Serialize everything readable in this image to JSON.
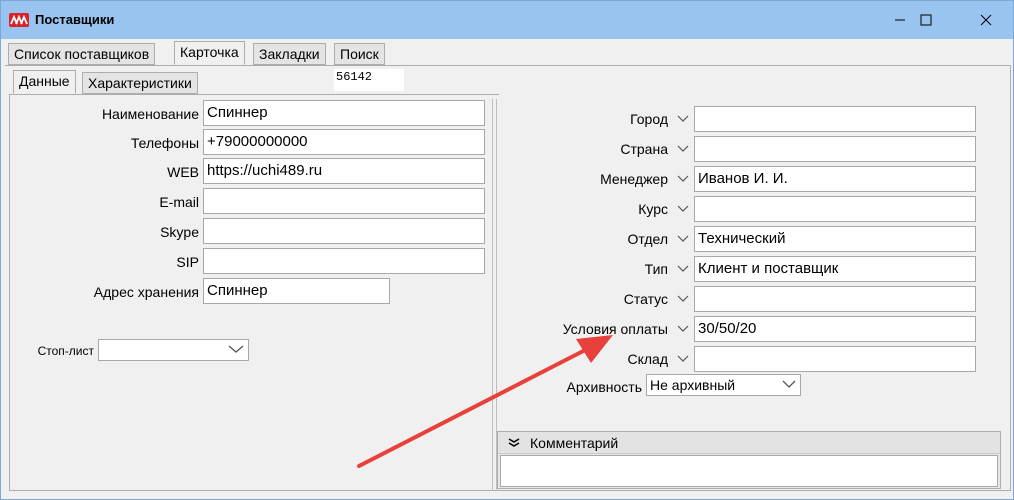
{
  "window": {
    "title": "Поставщики",
    "accent": "#99c4f0"
  },
  "top_tabs": [
    {
      "label": "Список поставщиков",
      "active": false
    },
    {
      "label": "Карточка",
      "active": true
    },
    {
      "label": "Закладки",
      "active": false
    },
    {
      "label": "Поиск",
      "active": false
    }
  ],
  "sub_tabs": [
    {
      "label": "Данные",
      "active": true
    },
    {
      "label": "Характеристики",
      "active": false
    }
  ],
  "record_id": "56142",
  "left_form": {
    "fields": [
      {
        "label": "Наименование",
        "value": "Спиннер"
      },
      {
        "label": "Телефоны",
        "value": "+79000000000"
      },
      {
        "label": "WEB",
        "value": "https://uchi489.ru"
      },
      {
        "label": "E-mail",
        "value": ""
      },
      {
        "label": "Skype",
        "value": ""
      },
      {
        "label": "SIP",
        "value": ""
      },
      {
        "label": "Адрес хранения",
        "value": "Спиннер"
      }
    ],
    "stoplist": {
      "label": "Стоп-лист",
      "value": ""
    }
  },
  "right_form": {
    "fields": [
      {
        "label": "Город",
        "value": ""
      },
      {
        "label": "Страна",
        "value": ""
      },
      {
        "label": "Менеджер",
        "value": "Иванов И. И."
      },
      {
        "label": "Курс",
        "value": ""
      },
      {
        "label": "Отдел",
        "value": "Технический"
      },
      {
        "label": "Тип",
        "value": "Клиент и поставщик"
      },
      {
        "label": "Статус",
        "value": ""
      },
      {
        "label": "Условия оплаты",
        "value": "30/50/20"
      },
      {
        "label": "Склад",
        "value": ""
      }
    ],
    "archive": {
      "label": "Архивность",
      "value": "Не архивный"
    }
  },
  "comment": {
    "label": "Комментарий",
    "value": ""
  },
  "annotation": {
    "color": "#e8403a"
  }
}
